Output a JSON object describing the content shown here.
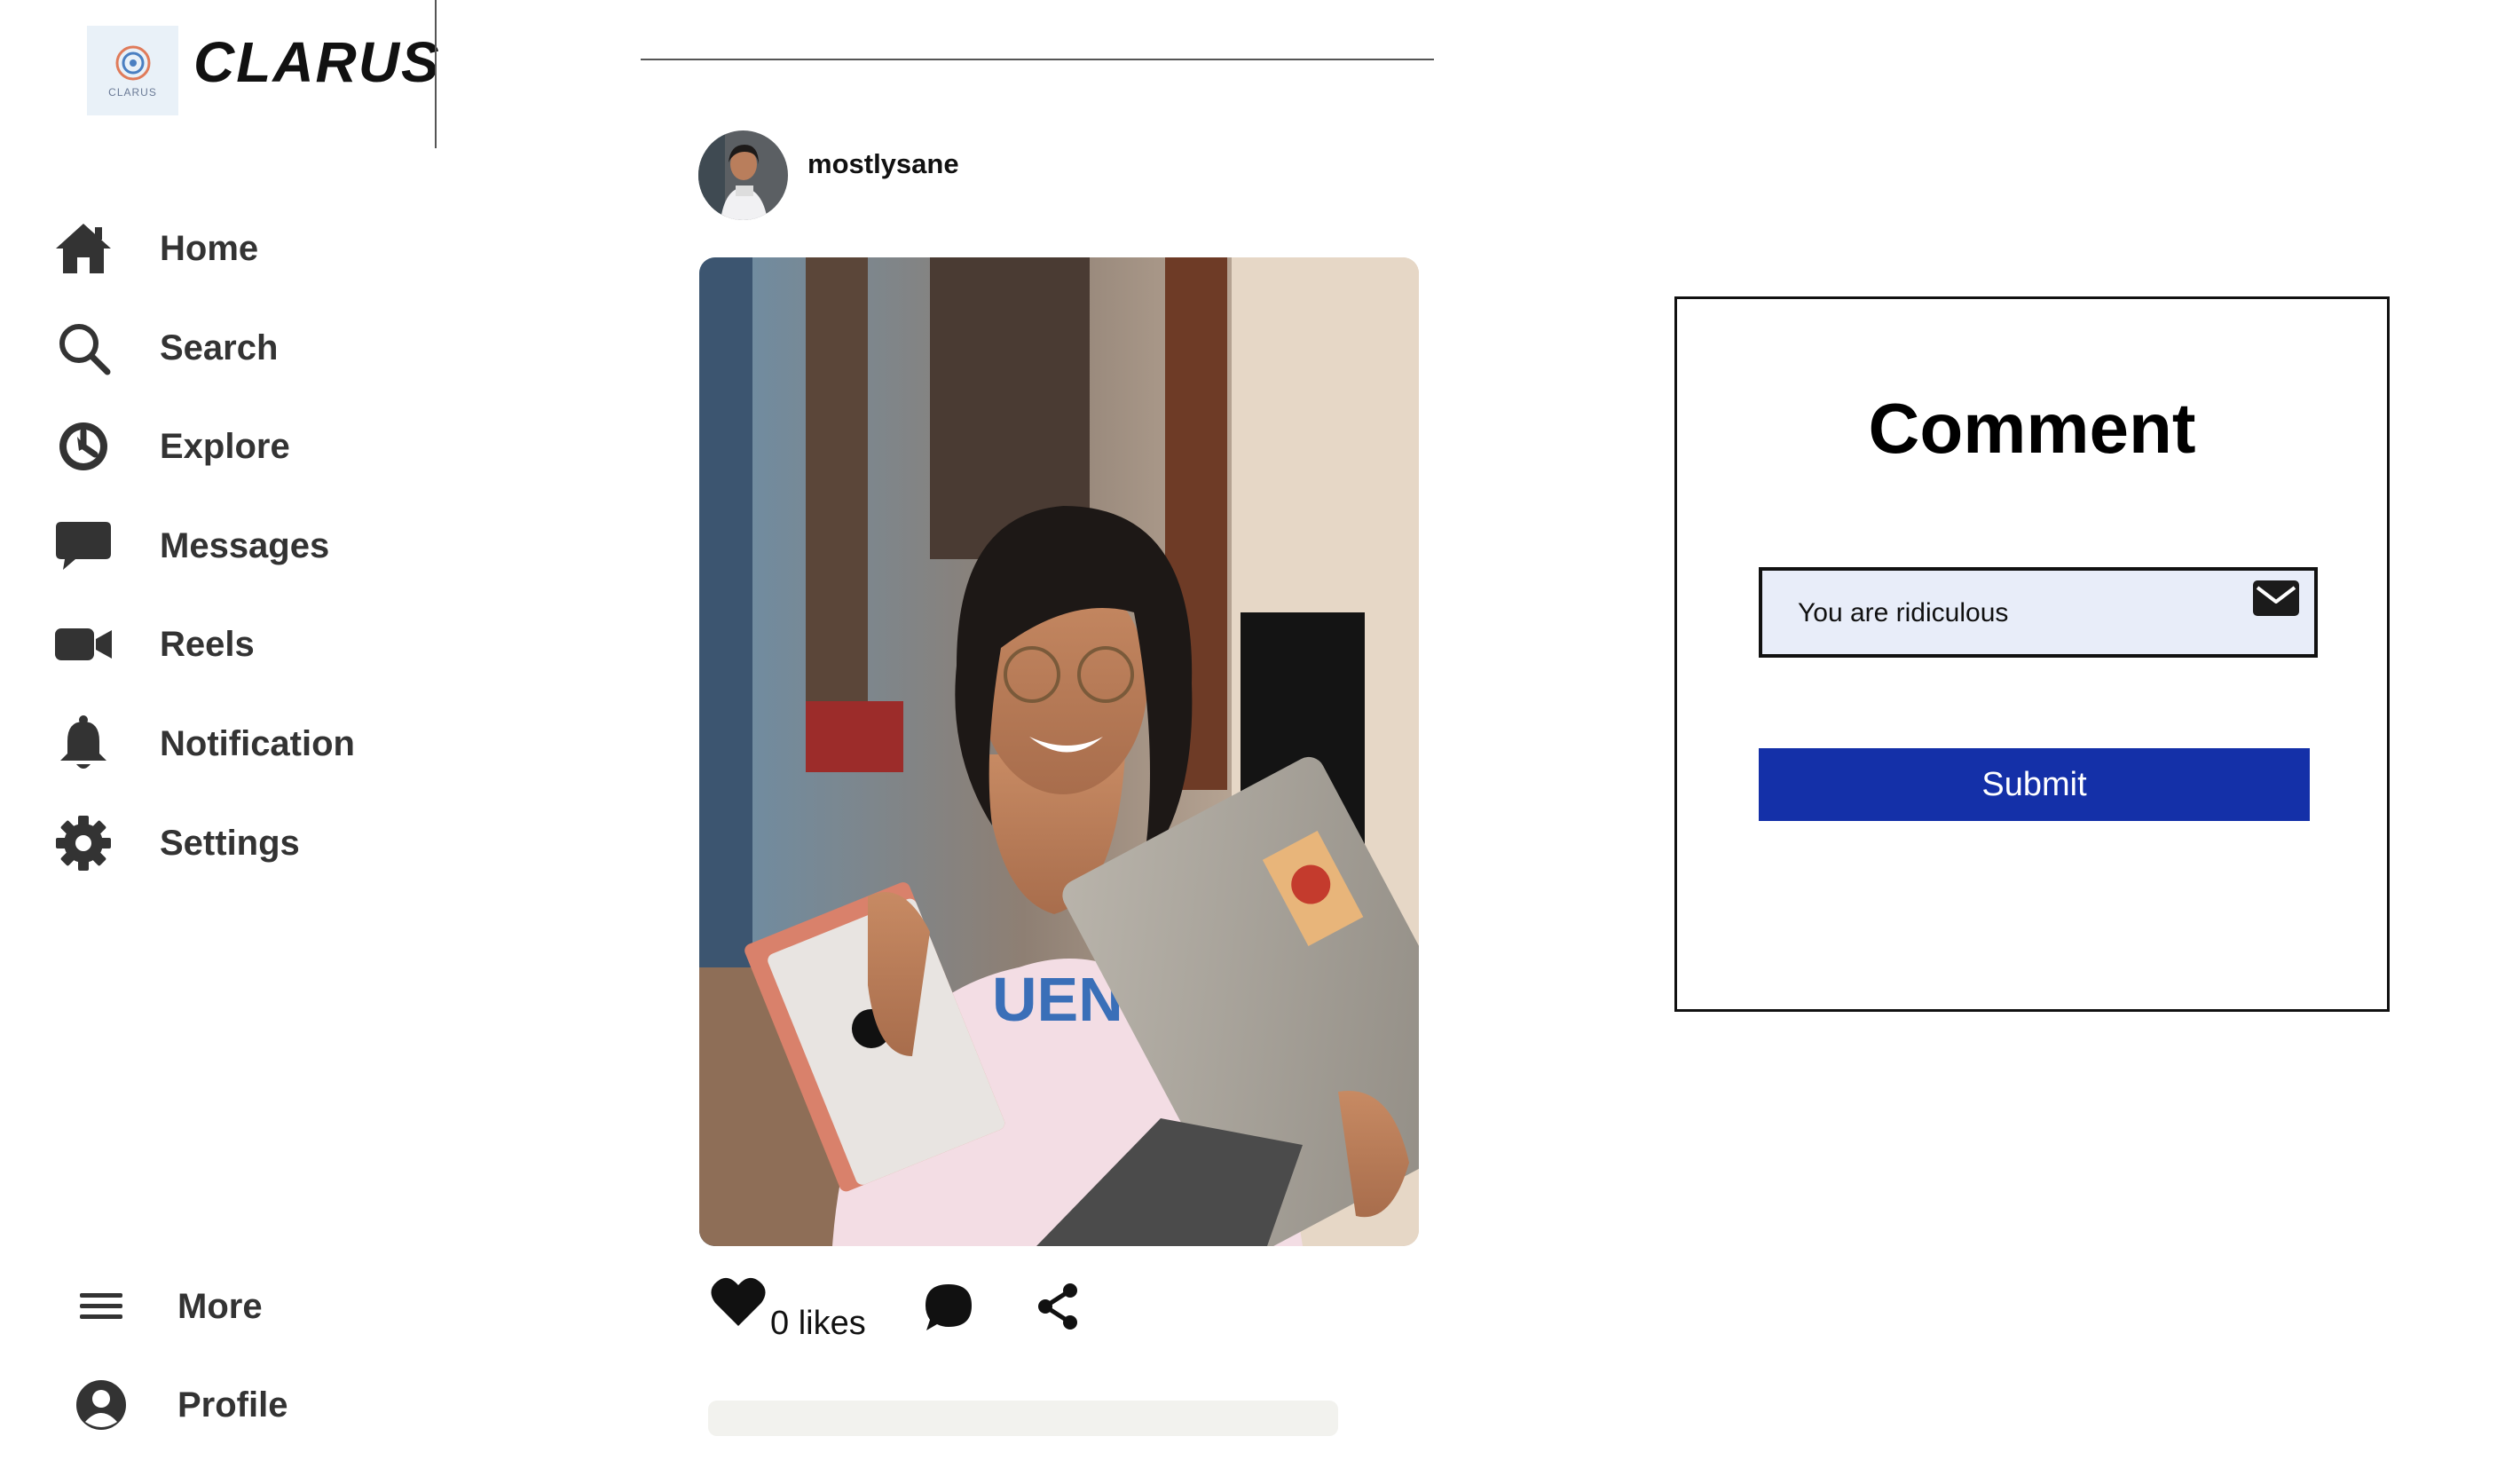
{
  "app": {
    "logo_small": "CLARUS",
    "brand": "CLARUS"
  },
  "sidebar": {
    "items": [
      {
        "label": "Home",
        "icon": "home-icon"
      },
      {
        "label": "Search",
        "icon": "search-icon"
      },
      {
        "label": "Explore",
        "icon": "compass-icon"
      },
      {
        "label": "Messages",
        "icon": "chat-bubble-icon"
      },
      {
        "label": "Reels",
        "icon": "video-camera-icon"
      },
      {
        "label": "Notification",
        "icon": "bell-icon"
      },
      {
        "label": "Settings",
        "icon": "gear-icon"
      }
    ],
    "bottom": [
      {
        "label": "More",
        "icon": "hamburger-icon"
      },
      {
        "label": "Profile",
        "icon": "user-circle-icon"
      }
    ]
  },
  "post": {
    "username": "mostlysane",
    "likes_text": "0 likes"
  },
  "comment_panel": {
    "title": "Comment",
    "input_value": "You are ridiculous",
    "submit_label": "Submit"
  },
  "colors": {
    "submit_bg": "#1430a8",
    "input_bg": "#e8edf9"
  }
}
